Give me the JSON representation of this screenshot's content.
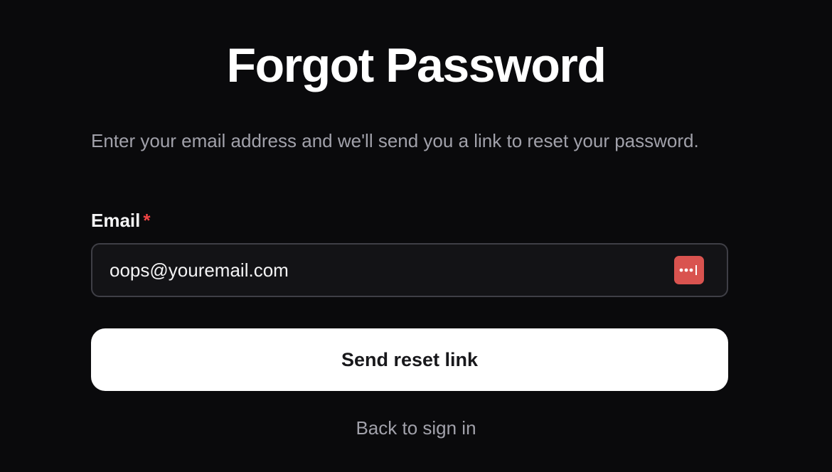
{
  "page": {
    "title": "Forgot Password",
    "description": "Enter your email address and we'll send you a link to reset your password."
  },
  "form": {
    "email_label": "Email",
    "required_marker": "*",
    "email_value": "oops@youremail.com",
    "password_manager_icon": "password-dots-icon",
    "submit_label": "Send reset link"
  },
  "footer": {
    "back_link": "Back to sign in"
  },
  "colors": {
    "background": "#0a0a0c",
    "required": "#ef4444",
    "password_manager": "#d9534f",
    "button_bg": "#ffffff"
  }
}
